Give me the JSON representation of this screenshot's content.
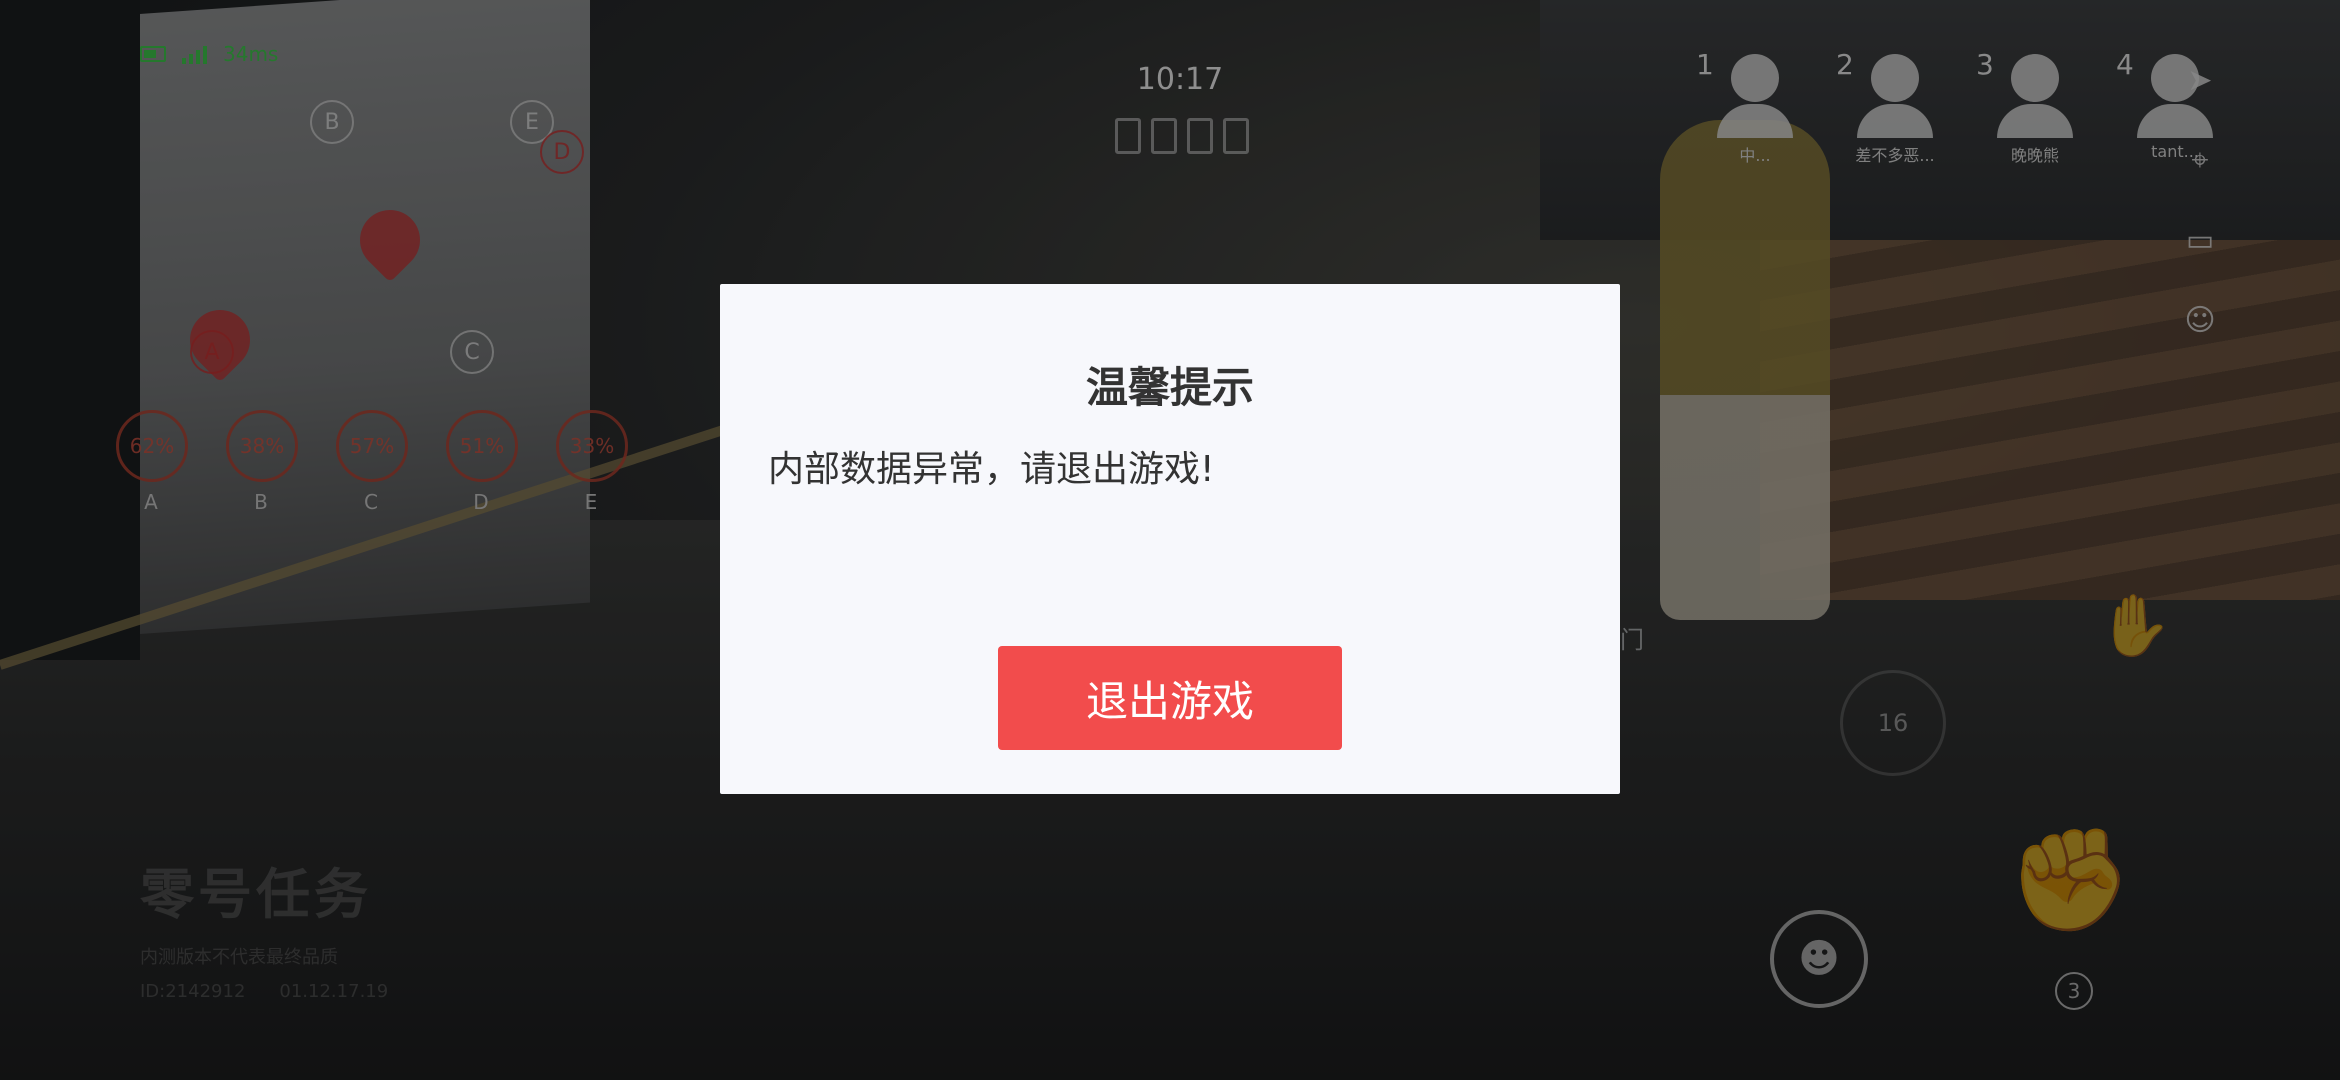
{
  "status": {
    "ping": "34ms",
    "colors": {
      "ok": "#3cc24a"
    }
  },
  "clock": {
    "time": "10:17"
  },
  "players": [
    {
      "num": "1",
      "name": "中..."
    },
    {
      "num": "2",
      "name": "差不多恶..."
    },
    {
      "num": "3",
      "name": "晚晚熊"
    },
    {
      "num": "4",
      "name": "tant..."
    }
  ],
  "objectives": [
    {
      "letter": "A",
      "progress": "62%"
    },
    {
      "letter": "B",
      "progress": "38%"
    },
    {
      "letter": "C",
      "progress": "57%"
    },
    {
      "letter": "D",
      "progress": "51%"
    },
    {
      "letter": "E",
      "progress": "33%"
    }
  ],
  "map_nodes": {
    "b": "B",
    "c": "C",
    "e": "E",
    "d": "D",
    "a": "A"
  },
  "side_icons": [
    "sprint-icon",
    "crosshair-icon",
    "chat-icon",
    "emoji-icon"
  ],
  "actions": {
    "count_16": "16",
    "fist_count": "3",
    "door_label": "门"
  },
  "watermark": {
    "logo": "零号任务",
    "notice": "内测版本不代表最终品质",
    "id": "ID:2142912",
    "version": "01.12.17.19"
  },
  "modal": {
    "title": "温馨提示",
    "message": "内部数据异常，请退出游戏!",
    "exit_label": "退出游戏",
    "colors": {
      "button": "#f24c4c",
      "background": "#f7f8fc"
    }
  }
}
